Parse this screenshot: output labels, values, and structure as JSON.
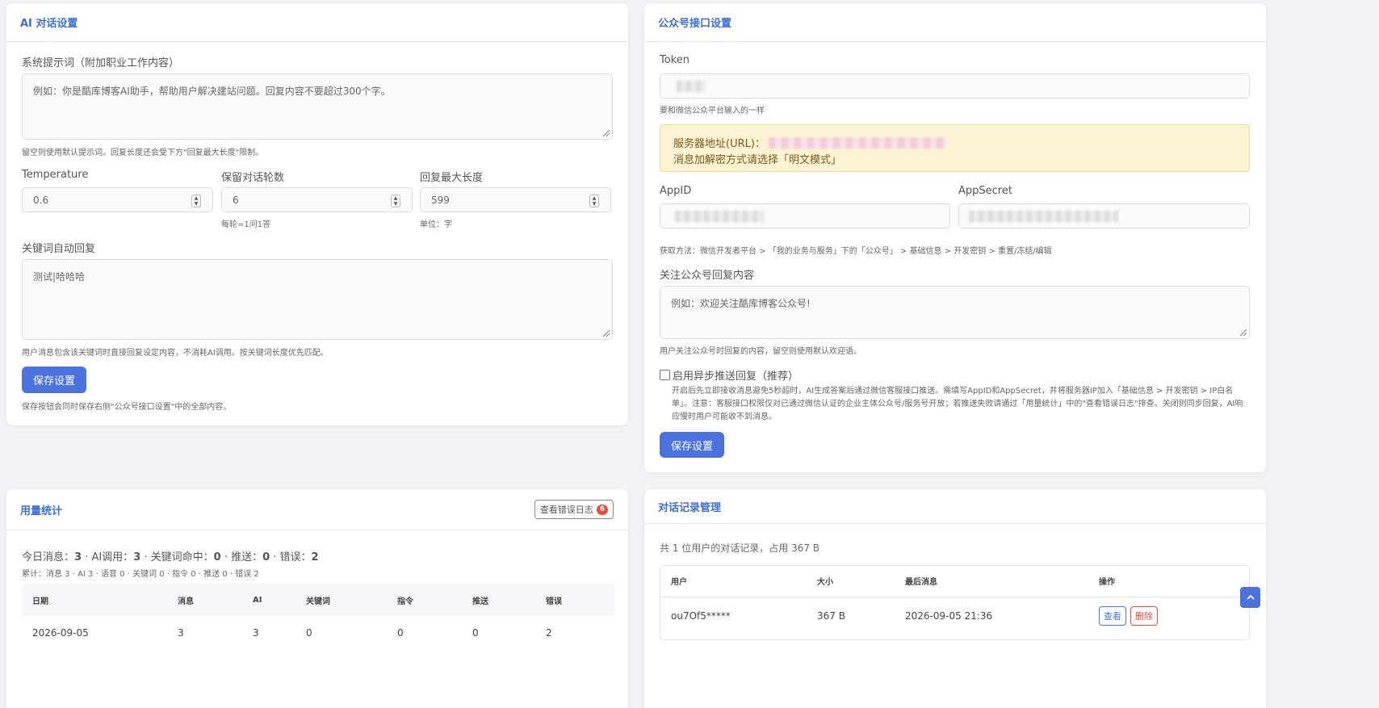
{
  "ai_settings": {
    "title": "AI 对话设置",
    "system_prompt": {
      "label": "系统提示词（附加职业工作内容）",
      "placeholder": "例如：你是酷库博客AI助手，帮助用户解决建站问题。回复内容不要超过300个字。",
      "hint": "留空则使用默认提示词。回复长度还会受下方\"回复最大长度\"限制。"
    },
    "temperature": {
      "label": "Temperature",
      "value": "0.6"
    },
    "rounds": {
      "label": "保留对话轮数",
      "value": "6",
      "hint": "每轮=1问1答"
    },
    "max_length": {
      "label": "回复最大长度",
      "value": "599",
      "hint": "单位：字"
    },
    "keyword_reply": {
      "label": "关键词自动回复",
      "value": "测试|哈哈哈",
      "hint": "用户消息包含该关键词时直接回复设定内容，不消耗AI调用。按关键词长度优先匹配。"
    },
    "save_label": "保存设置",
    "save_hint": "保存按钮会同时保存右侧\"公众号接口设置\"中的全部内容。"
  },
  "mp_settings": {
    "title": "公众号接口设置",
    "token": {
      "label": "Token",
      "hint": "要和微信公众平台输入的一样"
    },
    "server_url_label": "服务器地址(URL)：",
    "encrypt_note": "消息加解密方式请选择「明文模式」",
    "appid_label": "AppID",
    "appsecret_label": "AppSecret",
    "credentials_hint": "获取方法：微信开发者平台 > 「我的业务与服务」下的「公众号」 > 基础信息 > 开发密钥 > 重置/冻结/编辑",
    "follow_reply": {
      "label": "关注公众号回复内容",
      "placeholder": "例如：欢迎关注酷库博客公众号!",
      "hint": "用户关注公众号时回复的内容，留空则使用默认欢迎语。"
    },
    "async_push": {
      "label": "启用异步推送回复（推荐）",
      "desc": "开启后先立即接收消息避免5秒超时，AI生成答案后通过微信客服接口推送。需填写AppID和AppSecret，并将服务器IP加入「基础信息 > 开发密钥 > IP白名单」。注意：客服接口权限仅对已通过微信认证的企业主体公众号/服务号开放；若推送失败请通过「用量统计」中的\"查看错误日志\"排查。关闭则同步回复，AI响应慢时用户可能收不到消息。"
    },
    "save_label": "保存设置"
  },
  "usage": {
    "title": "用量统计",
    "error_log_label": "查看错误日志",
    "error_count": "6",
    "today": {
      "p1": "今日消息：",
      "msg": "3",
      "p2": " · AI调用：",
      "ai": "3",
      "p3": " · 关键词命中：",
      "kw": "0",
      "p4": " · 推送：",
      "push": "0",
      "p5": " · 错误：",
      "err": "2"
    },
    "total": "累计：消息 3 · AI 3 · 语音 0 · 关键词 0 · 指令 0 · 推送 0 · 错误 2",
    "columns": [
      "日期",
      "消息",
      "AI",
      "关键词",
      "指令",
      "推送",
      "错误"
    ],
    "rows": [
      [
        "2026-09-05",
        "3",
        "3",
        "0",
        "0",
        "0",
        "2"
      ]
    ]
  },
  "records": {
    "title": "对话记录管理",
    "summary": "共 1 位用户的对话记录，占用 367 B",
    "columns": [
      "用户",
      "大小",
      "最后消息",
      "操作"
    ],
    "rows": [
      {
        "user": "ou7Of5*****",
        "size": "367 B",
        "last": "2026-09-05 21:36"
      }
    ],
    "view_label": "查看",
    "delete_label": "删除"
  },
  "scroll_top_icon": "chevron-up-icon",
  "colors": {
    "primary": "#4a73e0",
    "title": "#3b6fd6",
    "danger": "#e74c3c",
    "warning_bg": "#fdf2d3"
  }
}
